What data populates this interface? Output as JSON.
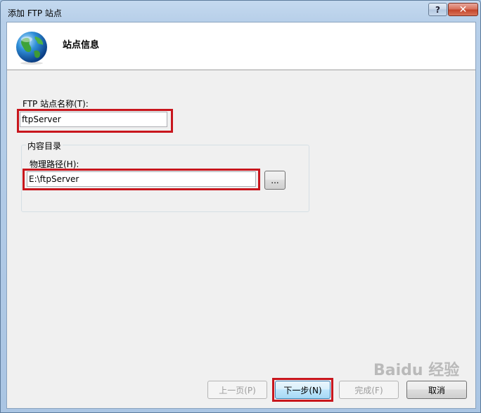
{
  "window": {
    "title": "添加 FTP 站点",
    "help_label": "?",
    "close_label": "✕"
  },
  "header": {
    "title": "站点信息",
    "icon": "globe-icon"
  },
  "form": {
    "site_name_label": "FTP 站点名称(T):",
    "site_name_value": "ftpServer",
    "content_group_label": "内容目录",
    "physical_path_label": "物理路径(H):",
    "physical_path_value": "E:\\ftpServer",
    "browse_label": "..."
  },
  "buttons": {
    "prev": "上一页(P)",
    "next": "下一步(N)",
    "finish": "完成(F)",
    "cancel": "取消"
  },
  "watermark": "Baidu 经验",
  "colors": {
    "highlight": "#c8161d",
    "title_bar": "#b7cfe9"
  }
}
